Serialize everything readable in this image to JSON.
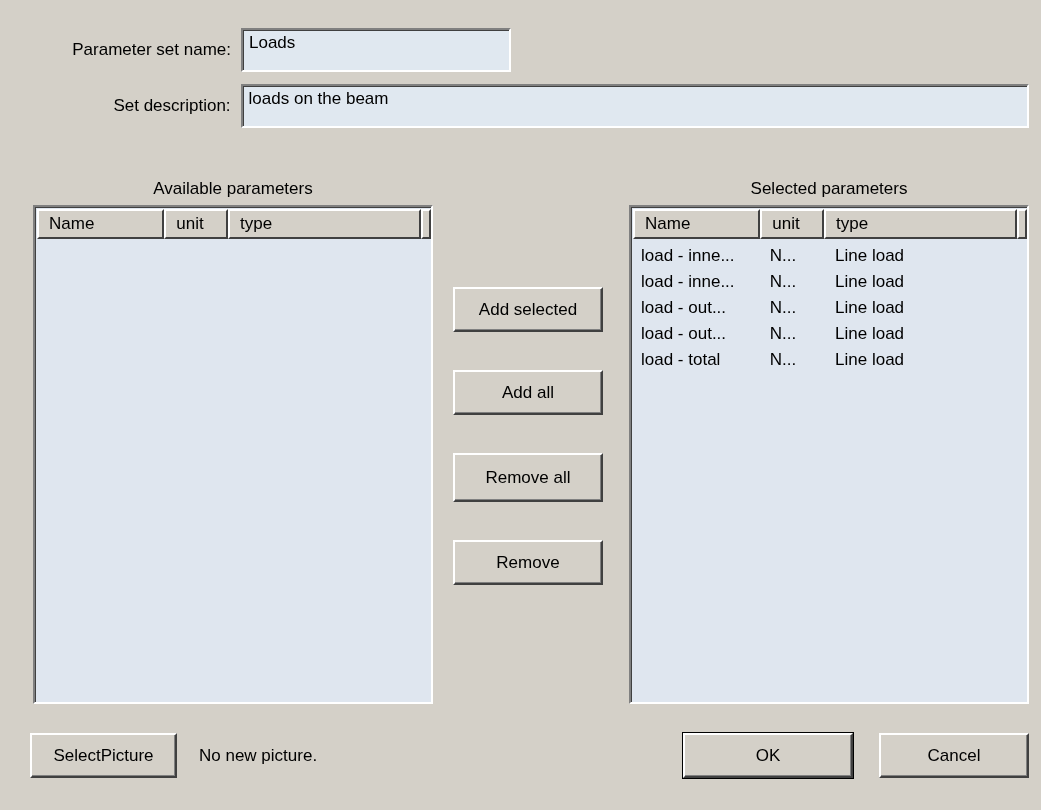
{
  "fields": [
    {
      "label": "Parameter set name:",
      "value": "Loads",
      "kind": "short"
    },
    {
      "label": "Set description:",
      "value": "loads on the beam",
      "kind": "wide"
    }
  ],
  "available": {
    "title": "Available parameters",
    "columns": [
      "Name",
      "unit",
      "type"
    ]
  },
  "actions": [
    "Add selected",
    "Add all",
    "Remove all",
    "Remove"
  ],
  "selected": {
    "title": "Selected parameters",
    "columns": [
      "Name",
      "unit",
      "type"
    ],
    "rows": [
      [
        "load - inne...",
        "N...",
        "Line load"
      ],
      [
        "load - inne...",
        "N...",
        "Line load"
      ],
      [
        "load - out...",
        "N...",
        "Line load"
      ],
      [
        "load - out...",
        "N...",
        "Line load"
      ],
      [
        "load - total",
        "N...",
        "Line load"
      ]
    ]
  },
  "picture_button": "SelectPicture",
  "picture_status": "No new picture.",
  "buttons": [
    {
      "label": "OK",
      "default": true
    },
    {
      "label": "Cancel",
      "default": false
    }
  ]
}
